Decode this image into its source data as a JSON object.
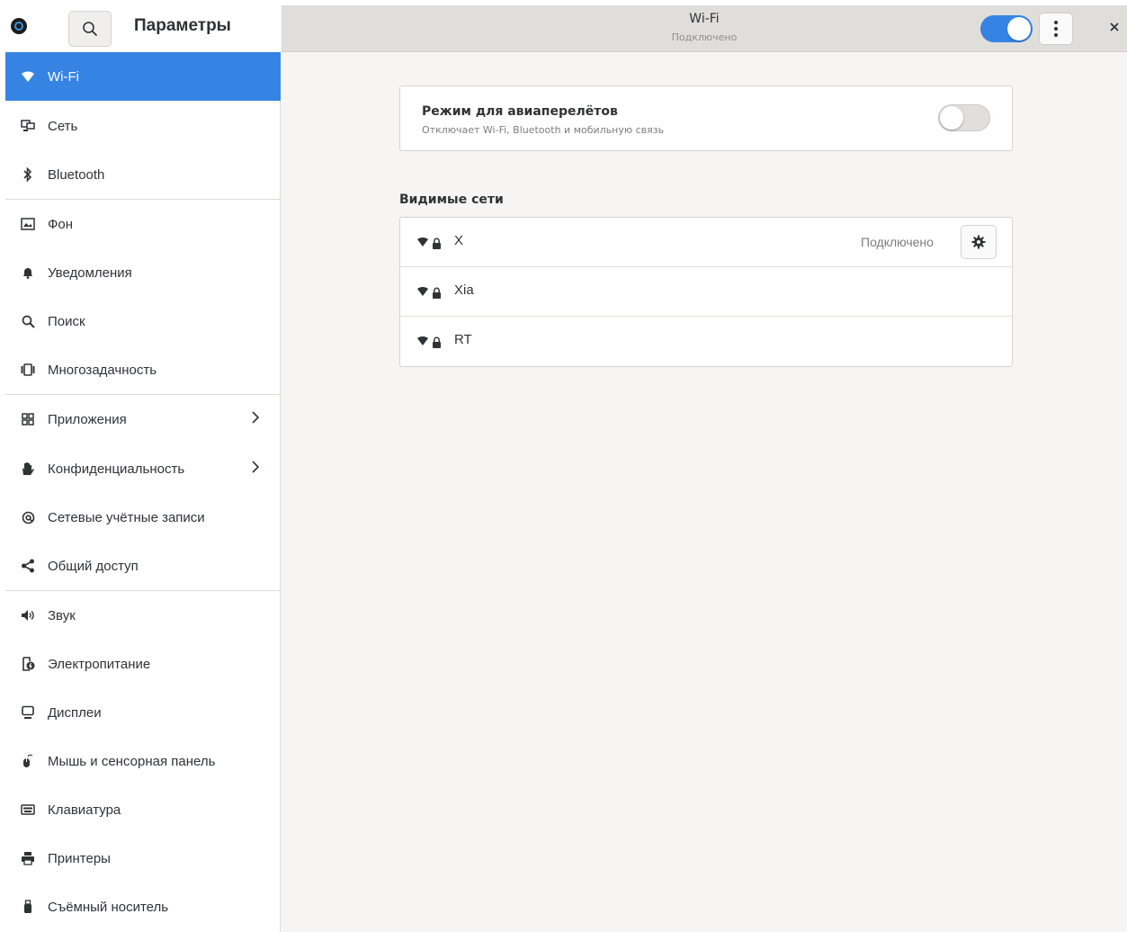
{
  "app": {
    "title": "Параметры"
  },
  "header": {
    "title": "Wi-Fi",
    "subtitle": "Подключено",
    "wifi_enabled": true
  },
  "sidebar": {
    "items": [
      {
        "label": "Wi-Fi",
        "icon": "wifi-icon",
        "active": true
      },
      {
        "label": "Сеть",
        "icon": "network-icon"
      },
      {
        "label": "Bluetooth",
        "icon": "bluetooth-icon"
      },
      {
        "label": "Фон",
        "icon": "background-icon"
      },
      {
        "label": "Уведомления",
        "icon": "bell-icon"
      },
      {
        "label": "Поиск",
        "icon": "search-icon"
      },
      {
        "label": "Многозадачность",
        "icon": "multitasking-icon"
      },
      {
        "label": "Приложения",
        "icon": "apps-icon",
        "arrow": true
      },
      {
        "label": "Конфиденциальность",
        "icon": "hand-icon",
        "arrow": true
      },
      {
        "label": "Сетевые учётные записи",
        "icon": "at-icon"
      },
      {
        "label": "Общий доступ",
        "icon": "share-icon"
      },
      {
        "label": "Звук",
        "icon": "speaker-icon"
      },
      {
        "label": "Электропитание",
        "icon": "power-icon"
      },
      {
        "label": "Дисплеи",
        "icon": "display-icon"
      },
      {
        "label": "Мышь и сенсорная панель",
        "icon": "mouse-icon"
      },
      {
        "label": "Клавиатура",
        "icon": "keyboard-icon"
      },
      {
        "label": "Принтеры",
        "icon": "printer-icon"
      },
      {
        "label": "Съёмный носитель",
        "icon": "usb-icon"
      }
    ]
  },
  "airplane": {
    "title": "Режим для авиаперелётов",
    "subtitle": "Отключает Wi-Fi, Bluetooth и мобильную связь",
    "enabled": false
  },
  "networks": {
    "title": "Видимые сети",
    "items": [
      {
        "name": "X",
        "status": "Подключено",
        "secured": true
      },
      {
        "name": "Xia",
        "status": "",
        "secured": true
      },
      {
        "name": "RT",
        "status": "",
        "secured": true
      }
    ]
  },
  "colors": {
    "accent": "#3584e4",
    "sidebar_bg": "#ffffff",
    "content_bg": "#f6f5f4",
    "header_bg": "#e0dedb"
  }
}
